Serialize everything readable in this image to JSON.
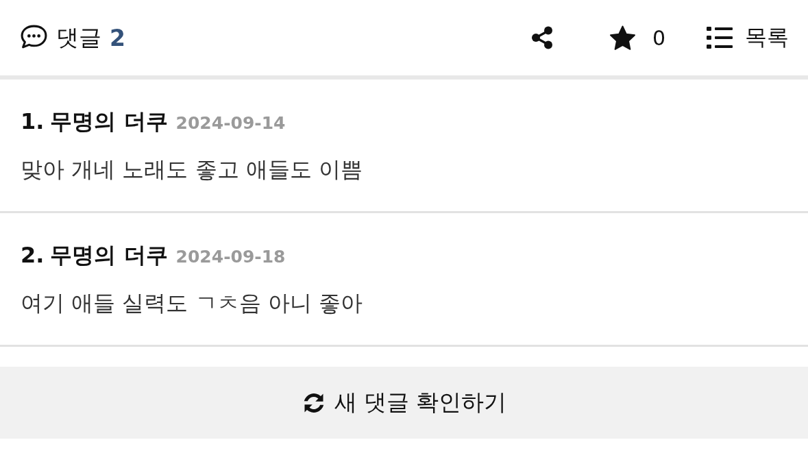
{
  "header": {
    "comments_label": "댓글",
    "comment_count": "2",
    "favorites_count": "0",
    "list_label": "목록"
  },
  "comments": [
    {
      "number": "1.",
      "author": "무명의 더쿠",
      "date": "2024-09-14",
      "text": "맞아 개네 노래도 좋고 애들도 이쁨"
    },
    {
      "number": "2.",
      "author": "무명의 더쿠",
      "date": "2024-09-18",
      "text": "여기 애들 실력도 ㄱㅊ음 아니 좋아"
    }
  ],
  "refresh_button": {
    "label": "새 댓글 확인하기"
  }
}
